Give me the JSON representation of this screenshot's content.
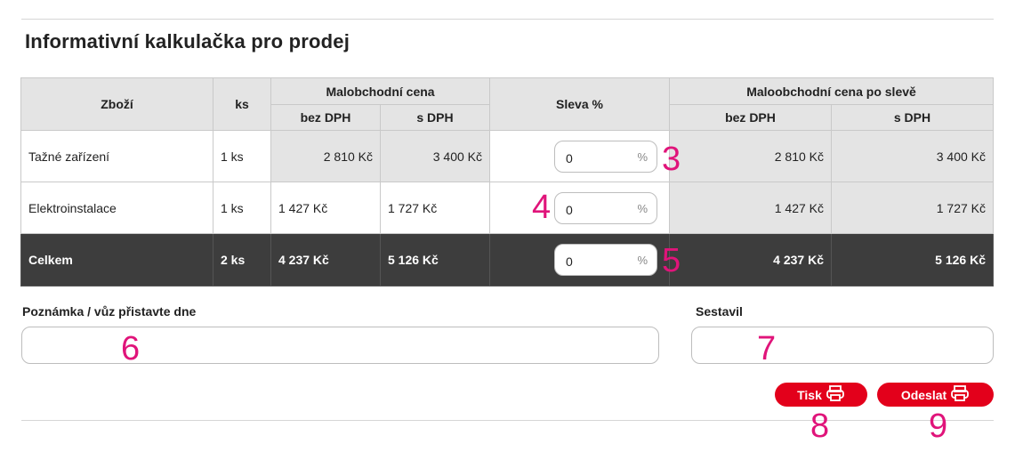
{
  "title": "Informativní kalkulačka pro prodej",
  "table": {
    "headers": {
      "item": "Zboží",
      "qty": "ks",
      "retail": "Malobchodní cena",
      "discount": "Sleva %",
      "retail_after": "Maloobchodní cena po slevě",
      "excl_vat": "bez DPH",
      "incl_vat": "s DPH"
    },
    "rows": [
      {
        "name": "Tažné zařízení",
        "qty": "1 ks",
        "price_excl": "2 810 Kč",
        "price_incl": "3 400 Kč",
        "discount": "0",
        "pct": "%",
        "after_excl": "2 810 Kč",
        "after_incl": "3 400 Kč"
      },
      {
        "name": "Elektroinstalace",
        "qty": "1 ks",
        "price_excl": "1 427 Kč",
        "price_incl": "1 727 Kč",
        "discount": "0",
        "pct": "%",
        "after_excl": "1 427 Kč",
        "after_incl": "1 727 Kč"
      }
    ],
    "total": {
      "name": "Celkem",
      "qty": "2 ks",
      "price_excl": "4 237 Kč",
      "price_incl": "5 126 Kč",
      "discount": "0",
      "pct": "%",
      "after_excl": "4 237 Kč",
      "after_incl": "5 126 Kč"
    }
  },
  "note": {
    "label": "Poznámka / vůz přistavte dne",
    "value": ""
  },
  "author": {
    "label": "Sestavil",
    "value": ""
  },
  "buttons": {
    "print": "Tisk",
    "send": "Odeslat"
  },
  "markers": {
    "m3": "3",
    "m4": "4",
    "m5": "5",
    "m6": "6",
    "m7": "7",
    "m8": "8",
    "m9": "9"
  },
  "colors": {
    "accent": "#e3001b",
    "marker": "#e0147a",
    "total_row": "#3d3d3d",
    "header_bg": "#e4e4e4"
  },
  "icons": {
    "print": "printer-icon"
  }
}
